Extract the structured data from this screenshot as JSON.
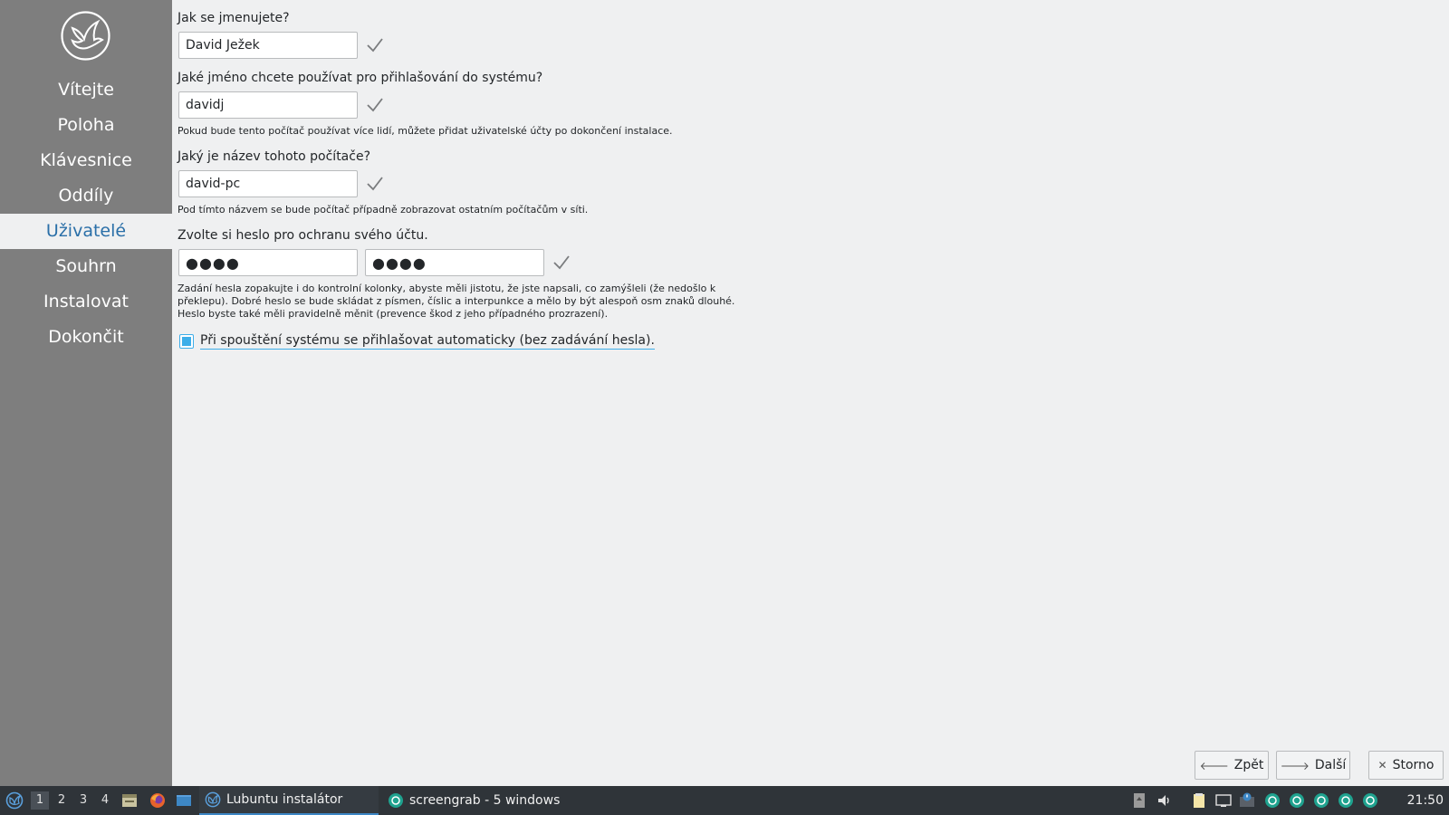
{
  "sidebar": {
    "items": [
      {
        "label": "Vítejte"
      },
      {
        "label": "Poloha"
      },
      {
        "label": "Klávesnice"
      },
      {
        "label": "Oddíly"
      },
      {
        "label": "Uživatelé"
      },
      {
        "label": "Souhrn"
      },
      {
        "label": "Instalovat"
      },
      {
        "label": "Dokončit"
      }
    ],
    "active_index": 4
  },
  "form": {
    "name_question": "Jak se jmenujete?",
    "name_value": "David Ježek",
    "login_question": "Jaké jméno chcete používat pro přihlašování do systému?",
    "login_value": "davidj",
    "login_hint": "Pokud bude tento počítač používat více lidí, můžete přidat uživatelské účty po dokončení instalace.",
    "host_question": "Jaký je název tohoto počítače?",
    "host_value": "david-pc",
    "host_hint": "Pod tímto názvem se bude počítač případně zobrazovat ostatním počítačům v síti.",
    "password_question": "Zvolte si heslo pro ochranu svého účtu.",
    "password_value": "●●●●",
    "password_repeat_value": "●●●●",
    "password_hint_1": "Zadání hesla zopakujte i do kontrolní kolonky, abyste měli jistotu, že jste napsali, co zamýšleli (že nedošlo k",
    "password_hint_2": "překlepu). Dobré heslo se bude skládat z písmen, číslic a interpunkce a mělo by být alespoň osm znaků dlouhé.",
    "password_hint_3": "Heslo byste také měli pravidelně měnit (prevence škod z jeho případného prozrazení).",
    "autologin_label": "Při spouštění systému se přihlašovat automaticky (bez zadávání hesla).",
    "autologin_checked": true
  },
  "buttons": {
    "back_label": "Zpět",
    "next_label": "Další",
    "cancel_label": "Storno"
  },
  "taskbar": {
    "workspaces": [
      "1",
      "2",
      "3",
      "4"
    ],
    "active_workspace": "1",
    "tasks": [
      {
        "label": "Lubuntu instalátor",
        "active": true
      },
      {
        "label": "screengrab - 5 windows",
        "active": false
      }
    ],
    "clock": "21:50"
  },
  "colors": {
    "sidebar_bg": "#7e7e7e",
    "accent": "#3daee9",
    "active_text": "#2a6fa8",
    "taskbar_bg": "#2f3439"
  }
}
